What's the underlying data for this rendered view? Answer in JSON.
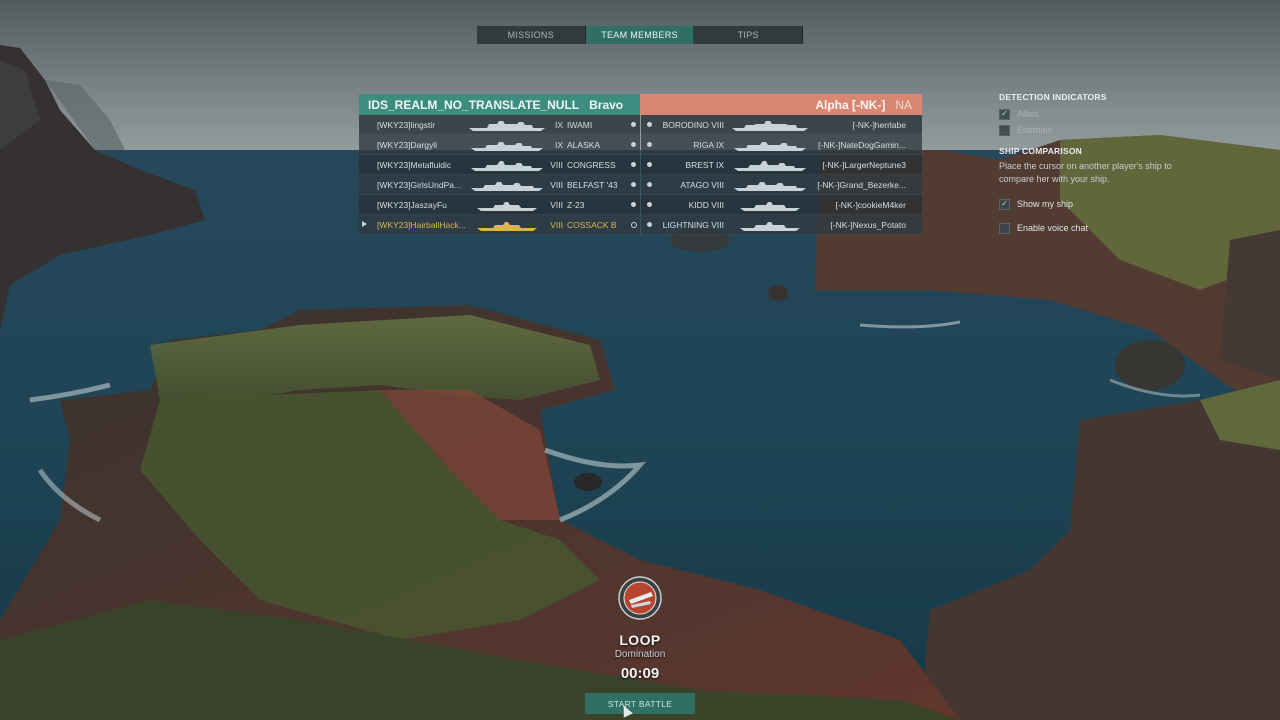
{
  "tabs": [
    {
      "label": "MISSIONS",
      "active": false
    },
    {
      "label": "TEAM MEMBERS",
      "active": true
    },
    {
      "label": "TIPS",
      "active": false
    }
  ],
  "team_left": {
    "realm": "IDS_REALM_NO_TRANSLATE_NULL",
    "name": "Bravo",
    "color": "#3c8d80",
    "players": [
      {
        "player": "[WKY23]lingstir",
        "tier": "IX",
        "ship": "IWAMI",
        "me": false
      },
      {
        "player": "[WKY23]Dargyli",
        "tier": "IX",
        "ship": "ALASKA",
        "me": false
      },
      {
        "player": "[WKY23]Metafluidic",
        "tier": "VIII",
        "ship": "CONGRESS",
        "me": false
      },
      {
        "player": "[WKY23]GirlsUndPa...",
        "tier": "VIII",
        "ship": "BELFAST '43",
        "me": false
      },
      {
        "player": "[WKY23]JaszayFu",
        "tier": "VIII",
        "ship": "Z-23",
        "me": false
      },
      {
        "player": "[WKY23]HairballHack...",
        "tier": "VIII",
        "ship": "COSSACK B",
        "me": true
      }
    ]
  },
  "team_right": {
    "name": "Alpha [-NK-]",
    "region": "NA",
    "color": "#d98773",
    "players": [
      {
        "tier_ship": "BORODINO VIII",
        "player": "[-NK-]herrlabe"
      },
      {
        "tier_ship": "RIGA IX",
        "player": "[-NK-]NateDogGamin..."
      },
      {
        "tier_ship": "BREST IX",
        "player": "[-NK-]LargerNeptune3"
      },
      {
        "tier_ship": "ATAGO VIII",
        "player": "[-NK-]Grand_Bezerke..."
      },
      {
        "tier_ship": "KIDD VIII",
        "player": "[-NK-]cookieM4ker"
      },
      {
        "tier_ship": "LIGHTNING VIII",
        "player": "[-NK-]Nexus_Potato"
      }
    ]
  },
  "side": {
    "detection_title": "DETECTION INDICATORS",
    "allies_label": "Allies",
    "enemies_label": "Enemies",
    "comparison_title": "SHIP COMPARISON",
    "comparison_text": "Place the cursor on another player's ship to compare her with your ship.",
    "show_my_ship_label": "Show my ship",
    "voice_chat_label": "Enable voice chat"
  },
  "battle": {
    "map_name": "LOOP",
    "mode": "Domination",
    "timer": "00:09",
    "start_label": "START BATTLE",
    "emblem_icon": "domination-emblem-icon"
  }
}
